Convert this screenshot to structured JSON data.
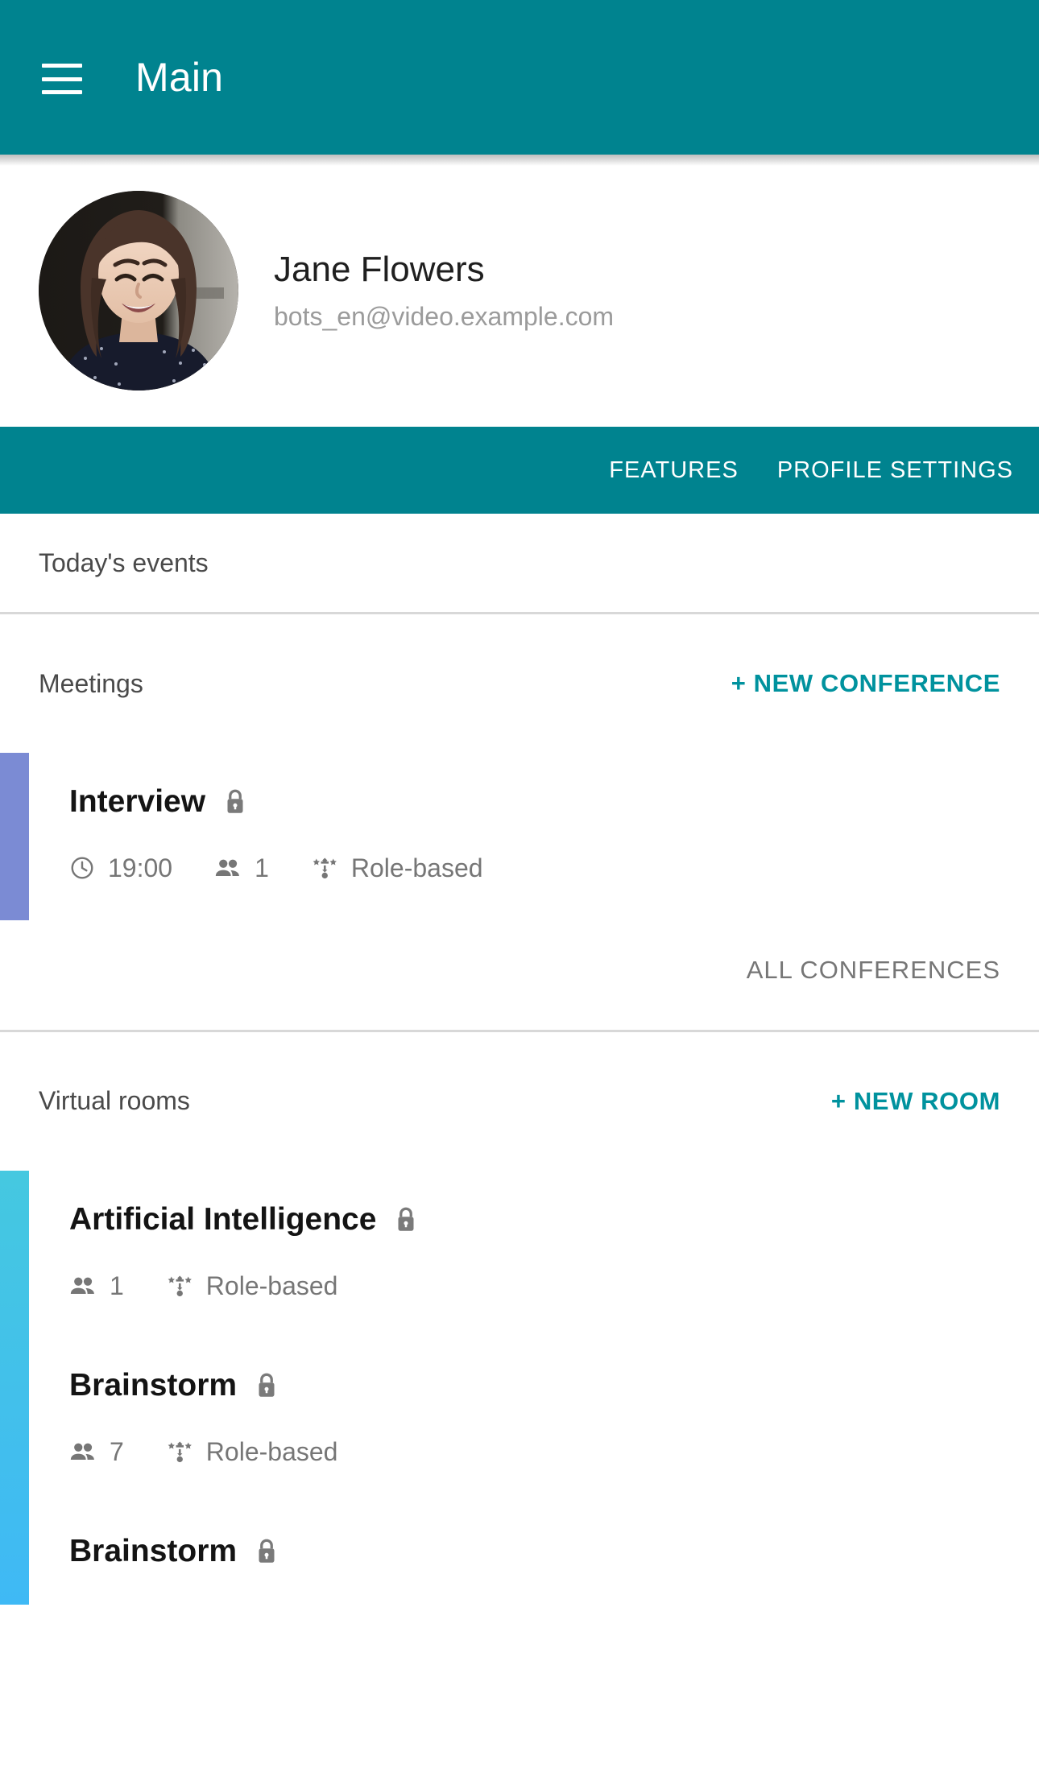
{
  "appbar": {
    "title": "Main",
    "menu_icon": "hamburger-menu-icon",
    "background": "#00838f"
  },
  "profile": {
    "name": "Jane Flowers",
    "email": "bots_en@video.example.com",
    "avatar_alt": "user-avatar"
  },
  "tabs": [
    {
      "label": "FEATURES"
    },
    {
      "label": "PROFILE SETTINGS"
    }
  ],
  "today": {
    "label": "Today's events"
  },
  "meetings": {
    "title": "Meetings",
    "new_action": "+ NEW CONFERENCE",
    "all_action": "ALL CONFERENCES",
    "accent_color": "#7b8bd4",
    "items": [
      {
        "name": "Interview",
        "locked": true,
        "time": "19:00",
        "participants": "1",
        "access": "Role-based"
      }
    ]
  },
  "rooms": {
    "title": "Virtual rooms",
    "new_action": "+ NEW ROOM",
    "accent_color": "#45c8e0",
    "items": [
      {
        "name": "Artificial Intelligence",
        "locked": true,
        "participants": "1",
        "access": "Role-based"
      },
      {
        "name": "Brainstorm",
        "locked": true,
        "participants": "7",
        "access": "Role-based"
      },
      {
        "name": "Brainstorm",
        "locked": true,
        "participants": "",
        "access": ""
      }
    ]
  },
  "icons": {
    "lock": "lock-icon",
    "clock": "clock-icon",
    "people": "people-icon",
    "role": "role-based-icon"
  }
}
